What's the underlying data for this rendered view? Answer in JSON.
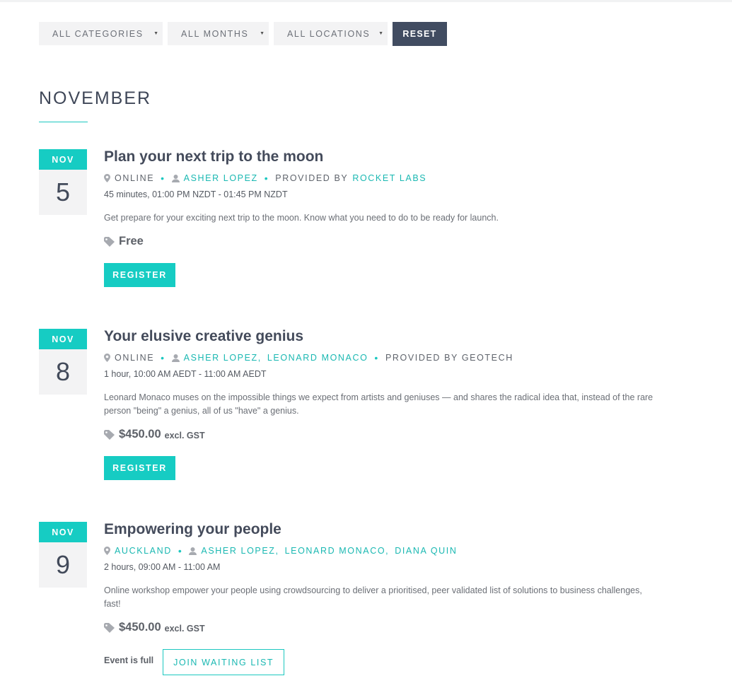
{
  "filters": {
    "categories": "ALL CATEGORIES",
    "months": "ALL MONTHS",
    "locations": "ALL LOCATIONS",
    "reset": "RESET"
  },
  "month_heading": "NOVEMBER",
  "separators": {
    "dot": "•",
    "comma": ","
  },
  "icons": {
    "location": "map-pin-icon",
    "person": "person-icon",
    "price": "price-tag-icon",
    "caret": "caret-down-icon"
  },
  "colors": {
    "accent": "#16ccc3",
    "dark": "#414c61",
    "light_bg": "#f3f3f4"
  },
  "events": [
    {
      "month": "NOV",
      "day": "5",
      "title": "Plan your next trip to the moon",
      "location": "ONLINE",
      "presenters": [
        "ASHER LOPEZ"
      ],
      "provided_by_label": "PROVIDED BY",
      "provider": "ROCKET LABS",
      "time": "45 minutes, 01:00 PM NZDT - 01:45 PM NZDT",
      "description": "Get prepare for your exciting next trip to the moon. Know what you need to do to be ready for launch.",
      "price": "Free",
      "price_suffix": "",
      "action": "REGISTER"
    },
    {
      "month": "NOV",
      "day": "8",
      "title": "Your elusive creative genius",
      "location": "ONLINE",
      "presenters": [
        "ASHER LOPEZ",
        "LEONARD MONACO"
      ],
      "provided_by_label": "PROVIDED BY GEOTECH",
      "provider": "",
      "time": "1 hour, 10:00 AM AEDT - 11:00 AM AEDT",
      "description": "Leonard Monaco muses on the impossible things we expect from artists and geniuses — and shares the radical idea that, instead of the rare person \"being\" a genius, all of us \"have\" a genius.",
      "price": "$450.00",
      "price_suffix": "excl. GST",
      "action": "REGISTER"
    },
    {
      "month": "NOV",
      "day": "9",
      "title": "Empowering your people",
      "location": "AUCKLAND",
      "presenters": [
        "ASHER LOPEZ",
        "LEONARD MONACO",
        "DIANA QUIN"
      ],
      "time": "2 hours, 09:00 AM - 11:00 AM",
      "description": "Online workshop empower your people using crowdsourcing to deliver a prioritised, peer validated list of solutions to business challenges, fast!",
      "price": "$450.00",
      "price_suffix": "excl. GST",
      "status_text": "Event is full",
      "action": "JOIN WAITING LIST"
    }
  ]
}
